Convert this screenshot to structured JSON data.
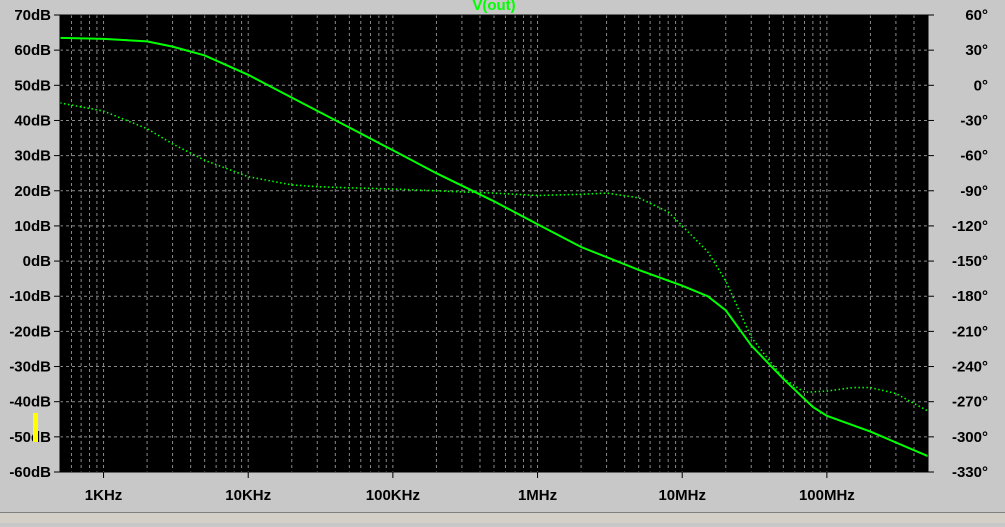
{
  "colors": {
    "background": "#000000",
    "grid": "#8a8a8a",
    "axis_text": "#000000",
    "trace": "#00ff00",
    "title": "#00ff00",
    "page": "#c8c8c8",
    "cursor_marker": "#ffff00"
  },
  "chart_data": {
    "type": "line",
    "title": "V(out)",
    "xlabel": "",
    "ylabel": "",
    "x_scale": "log",
    "xlim": [
      500,
      500000000
    ],
    "ylim": [
      -60,
      70
    ],
    "y2lim": [
      -330,
      60
    ],
    "grid": true,
    "legend": "none",
    "x_tick_values": [
      1000,
      10000,
      100000,
      1000000,
      10000000,
      100000000
    ],
    "x_tick_labels": [
      "1KHz",
      "10KHz",
      "100KHz",
      "1MHz",
      "10MHz",
      "100MHz"
    ],
    "y_tick_values": [
      70,
      60,
      50,
      40,
      30,
      20,
      10,
      0,
      -10,
      -20,
      -30,
      -40,
      -50,
      -60
    ],
    "y_tick_labels": [
      "70dB",
      "60dB",
      "50dB",
      "40dB",
      "30dB",
      "20dB",
      "10dB",
      "0dB",
      "-10dB",
      "-20dB",
      "-30dB",
      "-40dB",
      "-50dB",
      "-60dB"
    ],
    "y2_tick_values": [
      60,
      30,
      0,
      -30,
      -60,
      -90,
      -120,
      -150,
      -180,
      -210,
      -240,
      -270,
      -300,
      -330
    ],
    "y2_tick_labels": [
      "60°",
      "30°",
      "0°",
      "-30°",
      "-60°",
      "-90°",
      "-120°",
      "-150°",
      "-180°",
      "-210°",
      "-240°",
      "-270°",
      "-300°",
      "-330°"
    ],
    "series": [
      {
        "style": "solid",
        "axis": "left",
        "x": [
          500,
          1000,
          2000,
          3000,
          5000,
          10000,
          20000,
          50000,
          100000,
          200000,
          500000,
          1000000,
          2000000,
          5000000,
          10000000,
          15000000,
          20000000,
          30000000,
          50000000,
          80000000,
          100000000,
          200000000,
          500000000
        ],
        "y": [
          63.5,
          63.2,
          62.5,
          61,
          58.5,
          53,
          46.5,
          38,
          31.5,
          25,
          17,
          10.5,
          4,
          -2.5,
          -7,
          -10,
          -14,
          -24,
          -33.5,
          -41.5,
          -44,
          -48.5,
          -55.5
        ]
      },
      {
        "style": "dotted",
        "axis": "right",
        "x": [
          500,
          1000,
          2000,
          3000,
          5000,
          10000,
          20000,
          30000,
          50000,
          100000,
          200000,
          300000,
          500000,
          1000000,
          2000000,
          3000000,
          5000000,
          8000000,
          10000000,
          15000000,
          20000000,
          30000000,
          50000000,
          70000000,
          100000000,
          150000000,
          200000000,
          300000000,
          500000000
        ],
        "y": [
          -15,
          -22,
          -37,
          -50,
          -64,
          -78,
          -85,
          -86.5,
          -87.5,
          -88.5,
          -90,
          -91,
          -92,
          -94,
          -93,
          -92,
          -96,
          -108,
          -120,
          -142,
          -167,
          -215,
          -250,
          -262,
          -261,
          -258,
          -258,
          -263,
          -278
        ]
      }
    ]
  }
}
